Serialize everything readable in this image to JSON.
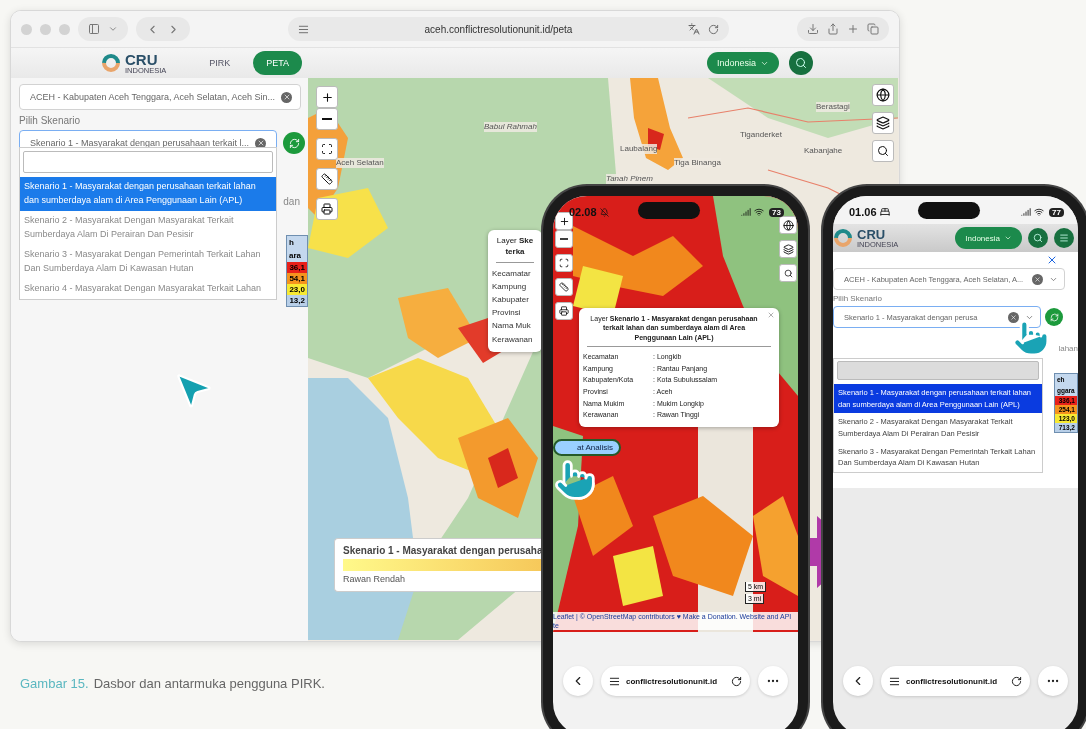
{
  "browser": {
    "url": "aceh.conflictresolutionunit.id/peta",
    "logo": {
      "name": "CRU",
      "sub": "INDONESIA"
    },
    "nav": [
      {
        "label": "PIRK",
        "selected": false
      },
      {
        "label": "PETA",
        "selected": true
      }
    ],
    "country": "Indonesia",
    "region_select": "ACEH - Kabupaten Aceh Tenggara, Aceh Selatan, Aceh Sin...",
    "scenario_label": "Pilih Skenario",
    "scenario_select": "Skenario 1 - Masyarakat dengan perusahaan terkait l...",
    "options": [
      {
        "label": "Skenario 1 - Masyarakat dengan perusahaan terkait lahan dan sumberdaya alam di Area Penggunaan Lain (APL)",
        "selected": true
      },
      {
        "label": "Skenario 2 - Masyarakat Dengan Masyarakat Terkait Sumberdaya Alam Di Perairan Dan Pesisir",
        "selected": false
      },
      {
        "label": "Skenario 3 - Masyarakat Dengan Pemerintah Terkait Lahan Dan Sumberdaya Alam Di Kawasan Hutan",
        "selected": false
      },
      {
        "label": "Skenario 4 - Masyarakat Dengan Masyarakat Terkait Lahan",
        "selected": false
      }
    ],
    "behind_text": "dan",
    "table_header": [
      "h",
      "ara"
    ],
    "table_values": [
      {
        "value": "36,1",
        "color": "#e8201a"
      },
      {
        "value": "54,1",
        "color": "#f5931e"
      },
      {
        "value": "23,0",
        "color": "#f7e932"
      },
      {
        "value": "13,2",
        "color": "#b8cfe8"
      }
    ],
    "map_labels": [
      "Aceh Selatan",
      "Babul Rahmah",
      "Laubalang",
      "Tiga Binanga",
      "Tiganderket",
      "Berastagi",
      "Kabanjahe",
      "Tanah Pinem"
    ],
    "popup": {
      "title_lines": [
        "Layer **Ske**",
        "**terka**"
      ],
      "fields": [
        "Kecamatar",
        "Kampung",
        "Kabupater",
        "Provinsi",
        "Nama Muk",
        "Kerawanan"
      ]
    },
    "legend": {
      "title": "Skenario 1 - Masyarakat dengan perusaha",
      "low": "Rawan Rendah"
    }
  },
  "phone_1": {
    "time": "02.08",
    "battery": "73",
    "popup": {
      "title": "Layer **Skenario 1 - Masyarakat dengan perusahaan terkait lahan dan sumberdaya alam di Area Penggunaan Lain (APL)**",
      "rows": [
        {
          "label": "Kecamatan",
          "value": ": Longkib"
        },
        {
          "label": "Kampung",
          "value": ": Rantau Panjang"
        },
        {
          "label": "Kabupaten/Kota",
          "value": ": Kota Subulussalam"
        },
        {
          "label": "Provinsi",
          "value": ": Aceh"
        },
        {
          "label": "Nama Mukim",
          "value": ": Mukim Longkip"
        },
        {
          "label": "Kerawanan",
          "value": ": Rawan Tinggi"
        }
      ]
    },
    "button": "at Analisis",
    "attribution": "Leaflet | © OpenStreetMap contributors ♥ Make a Donation. Website and API te",
    "scale": [
      "5 km",
      "3 mi"
    ],
    "url": "conflictresolutionunit.id"
  },
  "phone_2": {
    "time": "01.06",
    "battery": "77",
    "logo": {
      "name": "CRU",
      "sub": "INDONESIA"
    },
    "country": "Indonesia",
    "region_select": "ACEH - Kabupaten Aceh Tenggara, Aceh Selatan, A...",
    "scenario_label": "Pilih Skenario",
    "scenario_select": "Skenario 1 - Masyarakat dengan perusa",
    "options": [
      {
        "label": "Skenario 1 - Masyarakat dengan perusahaan terkait lahan dan sumberdaya alam di Area Penggunaan Lain (APL)",
        "selected": true
      },
      {
        "label": "Skenario 2 - Masyarakat Dengan Masyarakat Terkait Sumberdaya Alam Di Perairan Dan Pesisir",
        "selected": false
      },
      {
        "label": "Skenario 3 - Masyarakat Dengan Pemerintah Terkait Lahan Dan Sumberdaya Alam Di Kawasan Hutan",
        "selected": false
      }
    ],
    "behind_text": "lahan",
    "table_header": [
      "eh",
      "ggara"
    ],
    "table_values": [
      {
        "value": "336,1",
        "color": "#e8201a"
      },
      {
        "value": "254,1",
        "color": "#f5931e"
      },
      {
        "value": "123,0",
        "color": "#f7e932"
      },
      {
        "value": "713,2",
        "color": "#b8cfe8"
      }
    ],
    "url": "conflictresolutionunit.id"
  },
  "caption": {
    "label": "Gambar 15.",
    "text": "Dasbor dan antarmuka pengguna PIRK."
  }
}
